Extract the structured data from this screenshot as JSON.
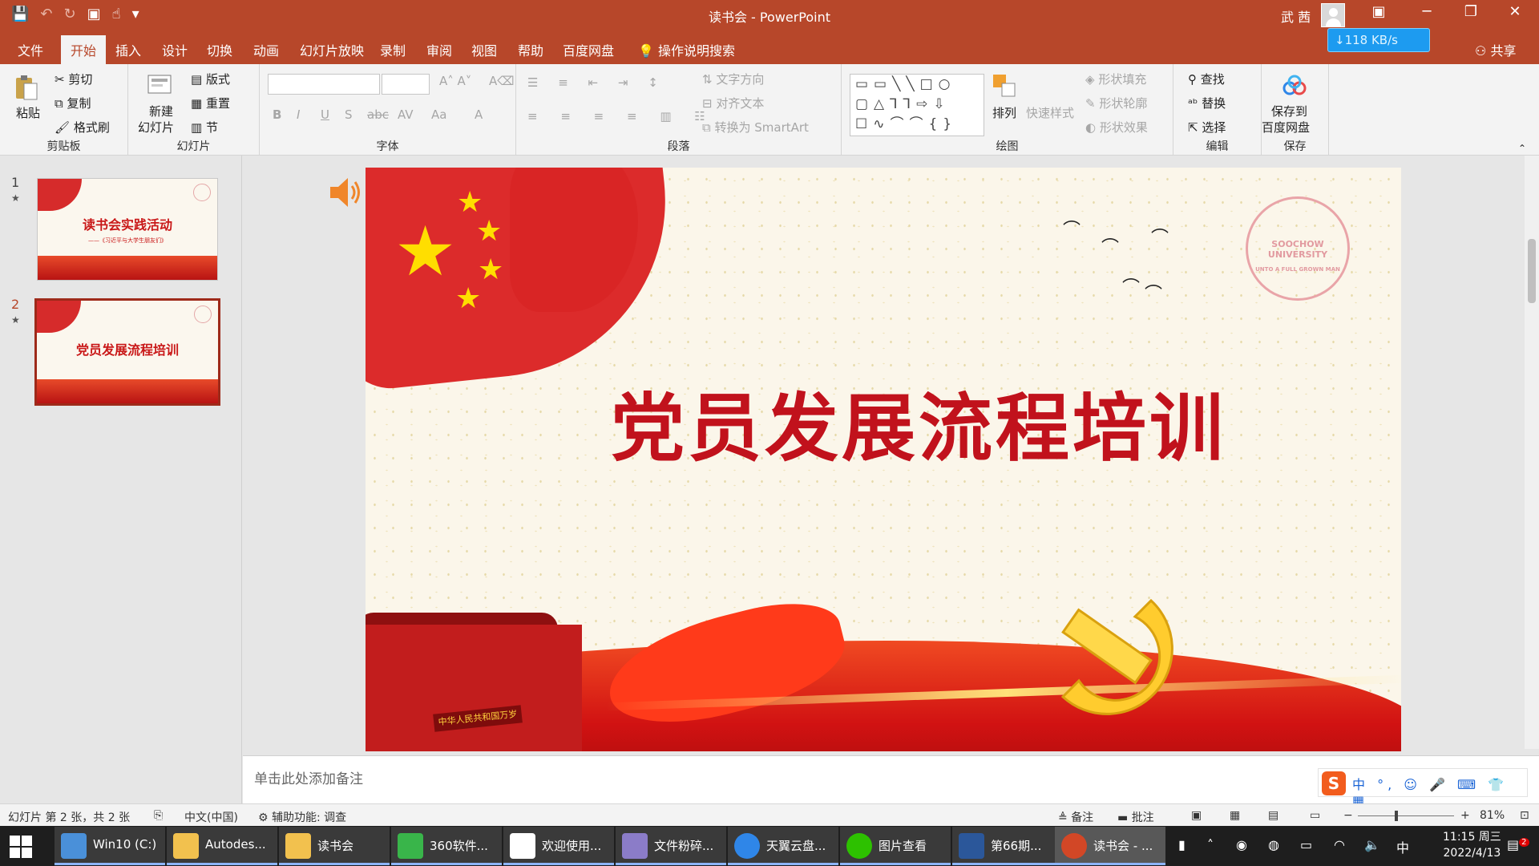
{
  "titlebar": {
    "title": "读书会 - PowerPoint",
    "user": "武 茜",
    "qat": [
      "save-icon",
      "undo-icon",
      "redo-icon",
      "present-icon",
      "touch-mode-icon",
      "customize-icon"
    ],
    "controls": {
      "ribbon_display": "▣",
      "minimize": "─",
      "restore": "❐",
      "close": "✕"
    }
  },
  "menu": {
    "tabs": [
      "文件",
      "开始",
      "插入",
      "设计",
      "切换",
      "动画",
      "幻灯片放映",
      "录制",
      "审阅",
      "视图",
      "帮助",
      "百度网盘"
    ],
    "active": "开始",
    "tell_me": "操作说明搜索",
    "share": "共享"
  },
  "netspeed": "↓118 KB/s",
  "ribbon": {
    "clipboard": {
      "label": "剪贴板",
      "paste": "粘贴",
      "cut": "剪切",
      "copy": "复制",
      "format_painter": "格式刷"
    },
    "slides": {
      "label": "幻灯片",
      "new_slide_1": "新建",
      "new_slide_2": "幻灯片",
      "layout": "版式",
      "reset": "重置",
      "section": "节"
    },
    "font": {
      "label": "字体",
      "buttons": [
        "B",
        "I",
        "U",
        "S",
        "abc",
        "AV",
        "Aa",
        "A"
      ]
    },
    "paragraph": {
      "label": "段落",
      "text_direction": "文字方向",
      "align_text": "对齐文本",
      "smartart": "转换为 SmartArt"
    },
    "drawing": {
      "label": "绘图",
      "arrange": "排列",
      "quick_styles": "快速样式",
      "fill": "形状填充",
      "outline": "形状轮廓",
      "effects": "形状效果"
    },
    "editing": {
      "label": "编辑",
      "find": "查找",
      "replace": "替换",
      "select": "选择"
    },
    "save": {
      "label": "保存",
      "save_to_1": "保存到",
      "save_to_2": "百度网盘"
    }
  },
  "slides": [
    {
      "number": "1",
      "title": "读书会实践活动",
      "subtitle": "——《习近平与大学生朋友们》"
    },
    {
      "number": "2",
      "title": "党员发展流程培训"
    }
  ],
  "current_slide": {
    "title": "党员发展流程培训",
    "seal_text": "SOOCHOW UNIVERSITY",
    "seal_motto": "UNTO A FULL GROWN MAN",
    "plaque": "中华人民共和国万岁"
  },
  "notes_placeholder": "单击此处添加备注",
  "ime": {
    "logo": "S",
    "text": "中 °, ☺ 🎤 ⌨ 👕 ▦"
  },
  "statusbar": {
    "slide_info": "幻灯片 第 2 张，共 2 张",
    "language": "中文(中国)",
    "accessibility": "辅助功能: 调查",
    "notes": "备注",
    "comments": "批注",
    "zoom": "81%"
  },
  "taskbar": {
    "apps": [
      {
        "label": "Win10 (C:)",
        "color": "#4a90d9"
      },
      {
        "label": "Autodes...",
        "color": "#f2c14e"
      },
      {
        "label": "读书会",
        "color": "#f2c14e"
      },
      {
        "label": "360软件...",
        "color": "#39b54a"
      },
      {
        "label": "欢迎使用...",
        "color": "#ffffff"
      },
      {
        "label": "文件粉碎...",
        "color": "#8b7cc8"
      },
      {
        "label": "天翼云盘...",
        "color": "#2f86e8"
      },
      {
        "label": "图片查看",
        "color": "#2dc100"
      },
      {
        "label": "第66期...",
        "color": "#2b579a"
      },
      {
        "label": "读书会 - ...",
        "color": "#d24726"
      }
    ],
    "time": "11:15 周三",
    "date": "2022/4/13",
    "ime_tray": "中",
    "notifications": "2"
  },
  "colors": {
    "accent": "#b7472a",
    "slide_title": "#c1121c"
  }
}
